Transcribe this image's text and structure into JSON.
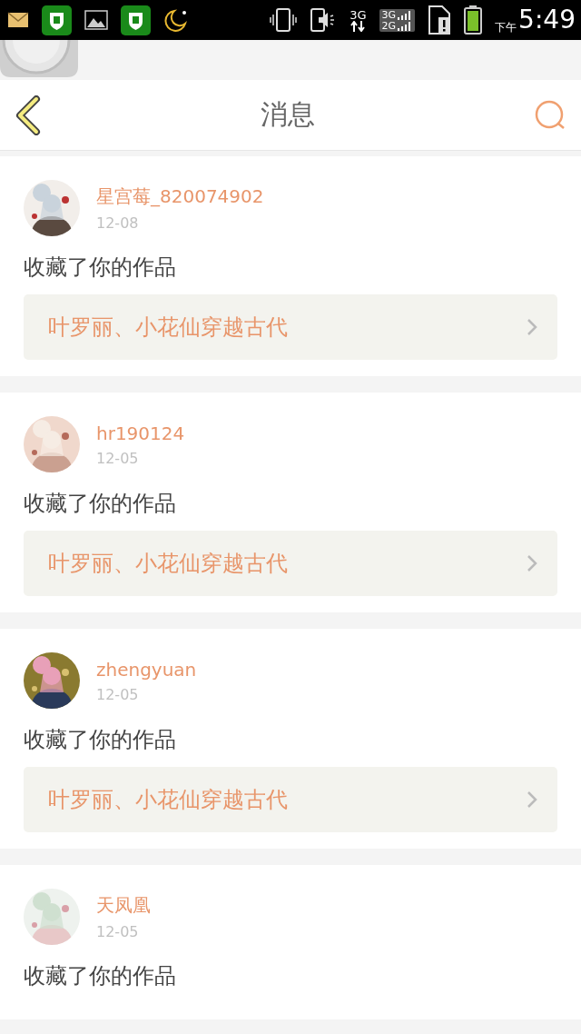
{
  "status_bar": {
    "network": "3G",
    "sim_1": "3G",
    "sim_2": "2G",
    "period": "下午",
    "time": "5:49"
  },
  "header": {
    "title": "消息"
  },
  "messages": [
    {
      "user": "星宫莓_820074902",
      "date": "12-08",
      "action": "收藏了你的作品",
      "work": "叶罗丽、小花仙穿越古代"
    },
    {
      "user": "hr190124",
      "date": "12-05",
      "action": "收藏了你的作品",
      "work": "叶罗丽、小花仙穿越古代"
    },
    {
      "user": "zhengyuan",
      "date": "12-05",
      "action": "收藏了你的作品",
      "work": "叶罗丽、小花仙穿越古代"
    },
    {
      "user": "天凤凰",
      "date": "12-05",
      "action": "收藏了你的作品"
    }
  ]
}
